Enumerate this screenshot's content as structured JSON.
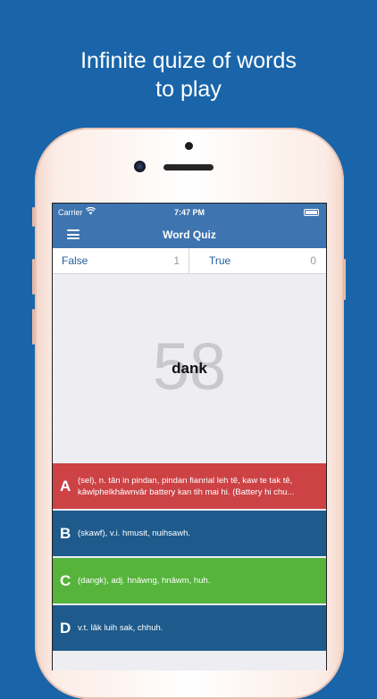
{
  "promo": {
    "line1": "Infinite quize of words",
    "line2": "to play"
  },
  "status_bar": {
    "carrier": "Carrier",
    "time": "7:47 PM"
  },
  "nav": {
    "title": "Word Quiz",
    "menu_icon": "hamburger-menu-icon"
  },
  "score": {
    "false_label": "False",
    "false_count": "1",
    "true_label": "True",
    "true_count": "0"
  },
  "question": {
    "countdown": "58",
    "word": "dank"
  },
  "answers": [
    {
      "letter": "A",
      "text": "(sel), n. tân in pindan, pindan fianrial leh tê, kaw te tak tê, kâwlphelkhâwnvâr battery kan tih mai hi. (Battery hi chu...",
      "color": "#cc4245"
    },
    {
      "letter": "B",
      "text": "(skawf), v.i. hmusit, nuihsawh.",
      "color": "#1e5b8c"
    },
    {
      "letter": "C",
      "text": "(dangk), adj. hnâwng, hnâwm, huh.",
      "color": "#56b43c"
    },
    {
      "letter": "D",
      "text": "v.t. lâk luih sak, chhuh.",
      "color": "#1e5b8c"
    }
  ]
}
